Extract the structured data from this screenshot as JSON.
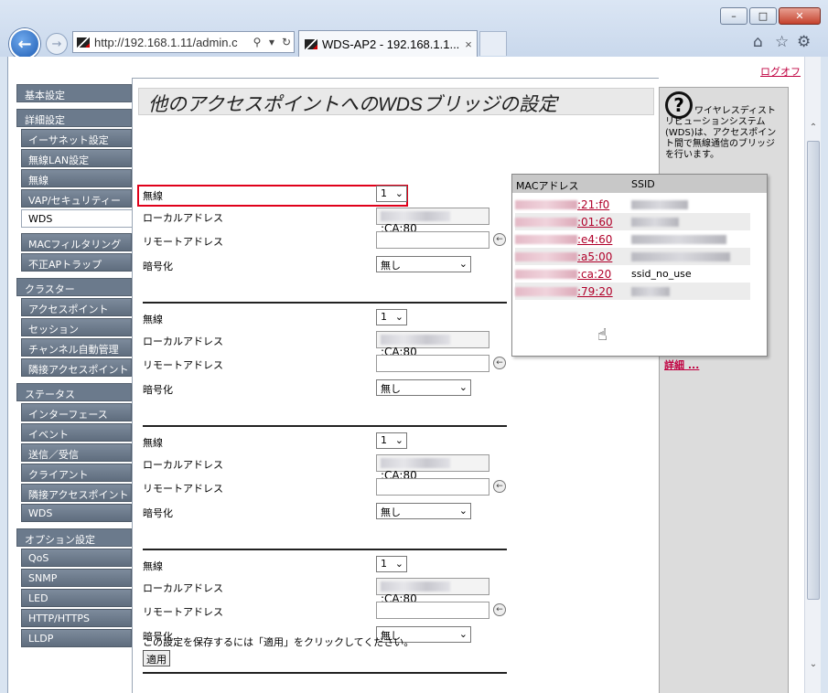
{
  "browser": {
    "address": "http://192.168.1.11/admin.c",
    "tab_title": "WDS-AP2 - 192.168.1.1...",
    "tab_close": "×",
    "window_buttons": [
      "–",
      "□",
      "✕"
    ],
    "icons": [
      "home-icon",
      "star-icon",
      "gear-icon"
    ]
  },
  "header": {
    "logout": "ログオフ"
  },
  "sidebar": {
    "sections": [
      {
        "title": "基本設定",
        "items": []
      },
      {
        "title": "詳細設定",
        "items": [
          "イーサネット設定",
          "無線LAN設定",
          "無線",
          "VAP/セキュリティー",
          "WDS",
          "MACフィルタリング",
          "不正APトラップ"
        ]
      },
      {
        "title": "クラスター",
        "items": [
          "アクセスポイント",
          "セッション",
          "チャンネル自動管理",
          "隣接アクセスポイント"
        ]
      },
      {
        "title": "ステータス",
        "items": [
          "インターフェース",
          "イベント",
          "送信／受信",
          "クライアント",
          "隣接アクセスポイント",
          "WDS"
        ]
      },
      {
        "title": "オプション設定",
        "items": [
          "QoS",
          "SNMP",
          "LED",
          "HTTP/HTTPS",
          "LLDP"
        ]
      }
    ],
    "active": "WDS"
  },
  "main": {
    "title": "他のアクセスポイントへのWDSブリッジの設定",
    "labels": {
      "radio": "無線",
      "local": "ローカルアドレス",
      "remote": "リモートアドレス",
      "encryption": "暗号化"
    },
    "groups": [
      {
        "radio": "1",
        "local_suffix": ":CA:80",
        "encryption": "無し"
      },
      {
        "radio": "1",
        "local_suffix": ":CA:80",
        "encryption": "無し"
      },
      {
        "radio": "1",
        "local_suffix": ":CA:80",
        "encryption": "無し"
      },
      {
        "radio": "1",
        "local_suffix": ":CA:80",
        "encryption": "無し"
      }
    ],
    "save_message": "この設定を保存するには「適用」をクリックしてください。",
    "apply_label": "適用"
  },
  "help": {
    "text": "ワイヤレスディストリビューションシステム(WDS)は、アクセスポイント間で無線通信のブリッジを行います。",
    "more": "詳細 ..."
  },
  "popup": {
    "col_mac": "MACアドレス",
    "col_ssid": "SSID",
    "rows": [
      {
        "mac_suffix": ":21:f0",
        "ssid": "",
        "ssid_w": 62
      },
      {
        "mac_suffix": ":01:60",
        "ssid": "",
        "ssid_w": 52
      },
      {
        "mac_suffix": ":e4:60",
        "ssid": "",
        "ssid_w": 104
      },
      {
        "mac_suffix": ":a5:00",
        "ssid": "",
        "ssid_w": 108
      },
      {
        "mac_suffix": ":ca:20",
        "ssid": "ssid_no_use",
        "ssid_w": 0
      },
      {
        "mac_suffix": ":79:20",
        "ssid": "",
        "ssid_w": 42
      }
    ]
  }
}
